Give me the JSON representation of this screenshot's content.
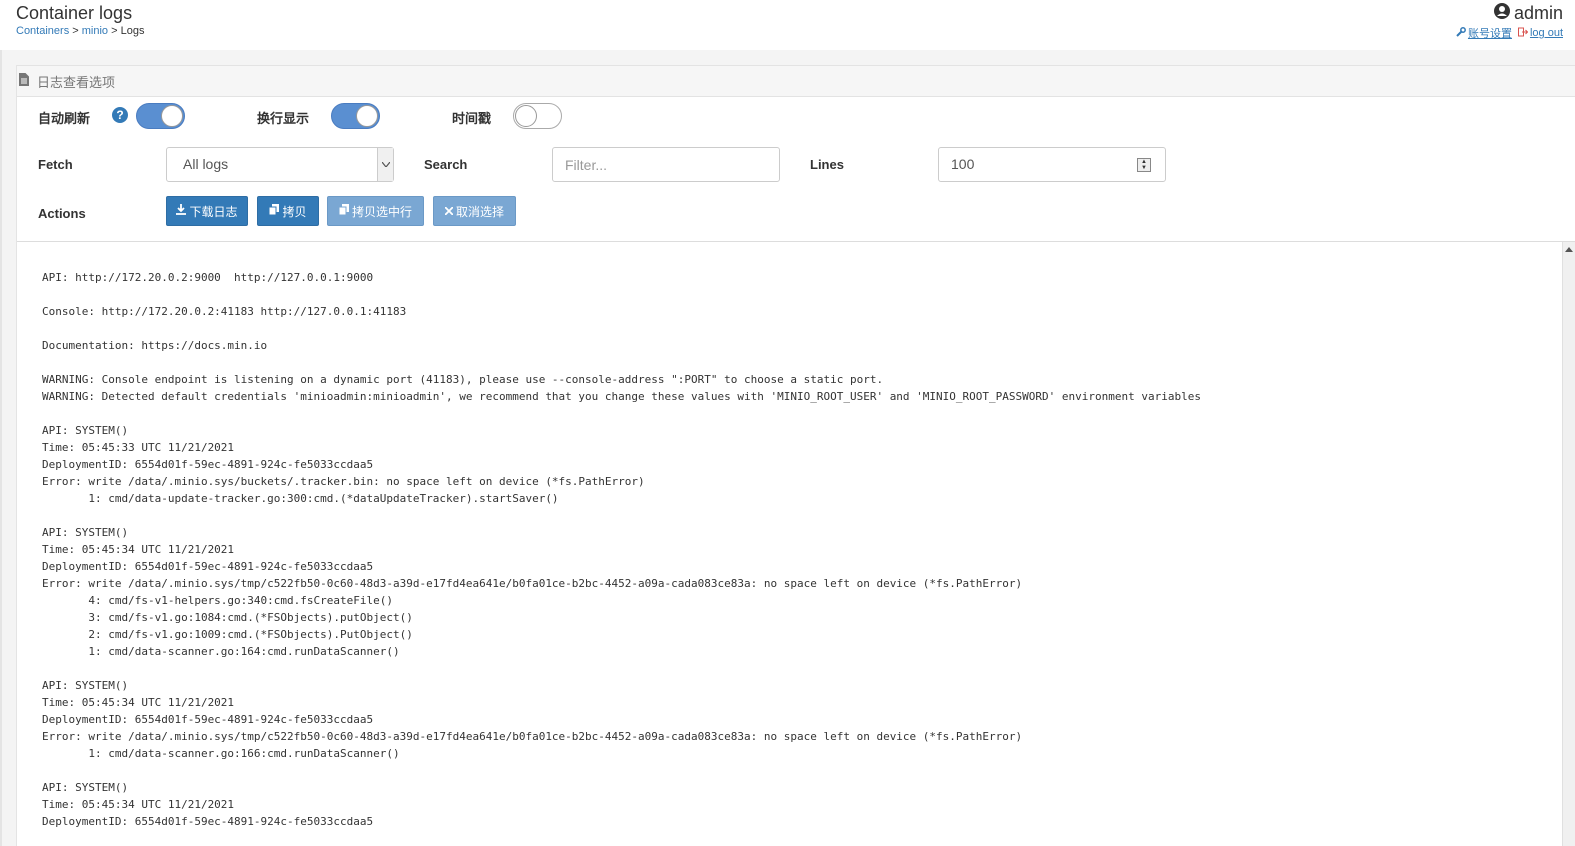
{
  "header": {
    "title": "Container logs",
    "breadcrumb": {
      "crumb1": "Containers",
      "sep1": " > ",
      "crumb2": "minio",
      "sep2": " > ",
      "current": "Logs"
    },
    "user": "admin",
    "account_link": "账号设置",
    "logout_link": "log out"
  },
  "panel": {
    "title": "日志查看选项",
    "auto_refresh_label": "自动刷新",
    "auto_refresh_on": true,
    "wrap_label": "换行显示",
    "wrap_on": true,
    "timestamp_label": "时间戳",
    "timestamp_on": false,
    "fetch_label": "Fetch",
    "fetch_value": "All logs",
    "search_label": "Search",
    "search_placeholder": "Filter...",
    "lines_label": "Lines",
    "lines_value": "100",
    "actions_label": "Actions",
    "buttons": {
      "download": "下载日志",
      "copy": "拷贝",
      "copy_selected": "拷贝选中行",
      "deselect": "取消选择"
    }
  },
  "colors": {
    "primary": "#337ab7",
    "primary_disabled": "#7aa7d3",
    "switch_on": "#5a8fd1"
  },
  "log_lines": [
    "API: http://172.20.0.2:9000  http://127.0.0.1:9000",
    "",
    "Console: http://172.20.0.2:41183 http://127.0.0.1:41183",
    "",
    "Documentation: https://docs.min.io",
    "",
    "WARNING: Console endpoint is listening on a dynamic port (41183), please use --console-address \":PORT\" to choose a static port.",
    "WARNING: Detected default credentials 'minioadmin:minioadmin', we recommend that you change these values with 'MINIO_ROOT_USER' and 'MINIO_ROOT_PASSWORD' environment variables",
    "",
    "API: SYSTEM()",
    "Time: 05:45:33 UTC 11/21/2021",
    "DeploymentID: 6554d01f-59ec-4891-924c-fe5033ccdaa5",
    "Error: write /data/.minio.sys/buckets/.tracker.bin: no space left on device (*fs.PathError)",
    "       1: cmd/data-update-tracker.go:300:cmd.(*dataUpdateTracker).startSaver()",
    "",
    "API: SYSTEM()",
    "Time: 05:45:34 UTC 11/21/2021",
    "DeploymentID: 6554d01f-59ec-4891-924c-fe5033ccdaa5",
    "Error: write /data/.minio.sys/tmp/c522fb50-0c60-48d3-a39d-e17fd4ea641e/b0fa01ce-b2bc-4452-a09a-cada083ce83a: no space left on device (*fs.PathError)",
    "       4: cmd/fs-v1-helpers.go:340:cmd.fsCreateFile()",
    "       3: cmd/fs-v1.go:1084:cmd.(*FSObjects).putObject()",
    "       2: cmd/fs-v1.go:1009:cmd.(*FSObjects).PutObject()",
    "       1: cmd/data-scanner.go:164:cmd.runDataScanner()",
    "",
    "API: SYSTEM()",
    "Time: 05:45:34 UTC 11/21/2021",
    "DeploymentID: 6554d01f-59ec-4891-924c-fe5033ccdaa5",
    "Error: write /data/.minio.sys/tmp/c522fb50-0c60-48d3-a39d-e17fd4ea641e/b0fa01ce-b2bc-4452-a09a-cada083ce83a: no space left on device (*fs.PathError)",
    "       1: cmd/data-scanner.go:166:cmd.runDataScanner()",
    "",
    "API: SYSTEM()",
    "Time: 05:45:34 UTC 11/21/2021",
    "DeploymentID: 6554d01f-59ec-4891-924c-fe5033ccdaa5"
  ]
}
